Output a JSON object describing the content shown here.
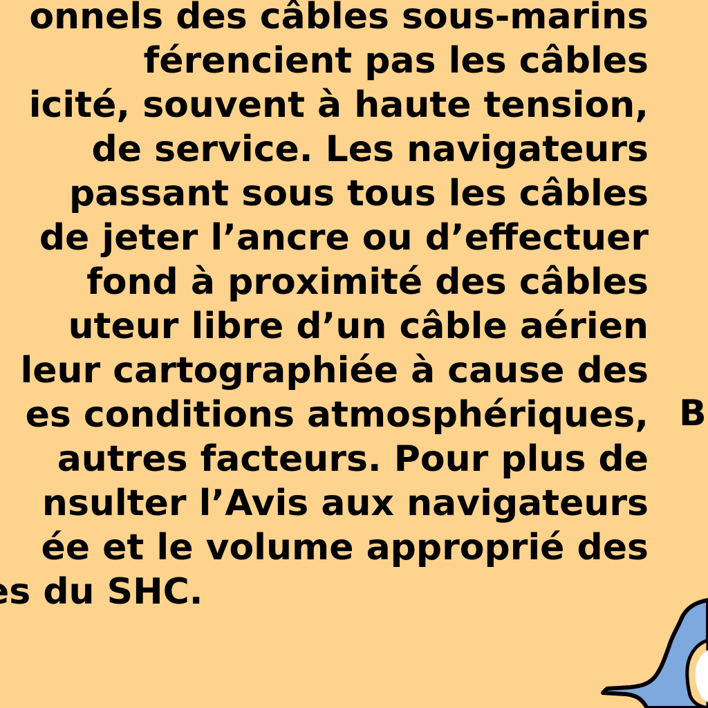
{
  "note": {
    "lines": [
      "onnels des câbles sous-marins",
      "férencient pas les câbles",
      "icité, souvent à haute tension,",
      "de service. Les navigateurs",
      "passant sous tous les câbles",
      "de jeter l’ancre ou d’effectuer",
      "fond à proximité des câbles",
      "uteur libre d’un câble aérien",
      "leur cartographiée à cause des",
      "es conditions atmosphériques,",
      "autres facteurs. Pour plus de",
      "nsulter l’Avis aux navigateurs",
      "ée et le volume approprié des",
      "es du SHC."
    ]
  },
  "side_label": "B",
  "colors": {
    "land": "#FED38E",
    "water": "#7EA9DF",
    "shoreline": "#000000",
    "text": "#000000"
  }
}
